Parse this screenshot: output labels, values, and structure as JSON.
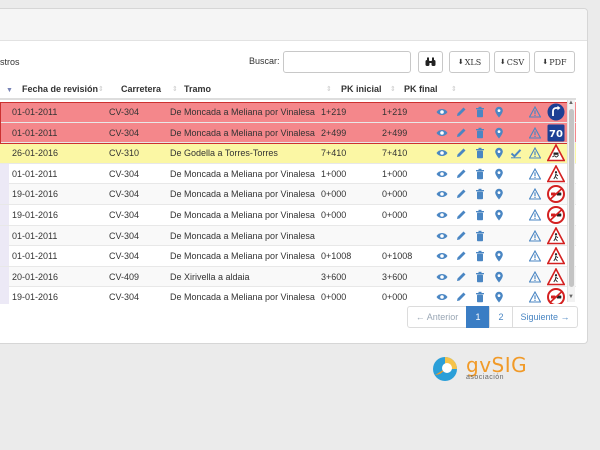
{
  "table_controls": {
    "length_label": "stros",
    "search_label": "Buscar:",
    "search_value": "",
    "export_xls": "XLS",
    "export_csv": "CSV",
    "export_pdf": "PDF",
    "download_glyph": "⬇"
  },
  "columns": [
    "Fecha de revisión",
    "Carretera",
    "Tramo",
    "PK inicial",
    "PK final"
  ],
  "rows": [
    {
      "fecha": "01-01-2011",
      "carretera": "CV-304",
      "tramo": "De Moncada a Meliana por Vinalesa",
      "pk_inicial": "1+219",
      "pk_final": "1+219",
      "state": "red",
      "actions": [
        "eye-icon",
        "pencil-icon",
        "trash-icon",
        "map-marker-icon",
        "warning-icon"
      ],
      "sign": "sign-direction-icon"
    },
    {
      "fecha": "01-01-2011",
      "carretera": "CV-304",
      "tramo": "De Moncada a Meliana por Vinalesa",
      "pk_inicial": "2+499",
      "pk_final": "2+499",
      "state": "red",
      "actions": [
        "eye-icon",
        "pencil-icon",
        "trash-icon",
        "map-marker-icon",
        "warning-icon"
      ],
      "sign": "sign-speed-70-icon",
      "sign_text": "70"
    },
    {
      "fecha": "26-01-2016",
      "carretera": "CV-310",
      "tramo": "De Godella a Torres-Torres",
      "pk_inicial": "7+410",
      "pk_final": "7+410",
      "state": "yellow",
      "actions": [
        "eye-icon",
        "pencil-icon",
        "trash-icon",
        "map-marker-icon",
        "check-icon",
        "warning-icon"
      ],
      "sign": "sign-slippery-road-icon"
    },
    {
      "fecha": "01-01-2011",
      "carretera": "CV-304",
      "tramo": "De Moncada a Meliana por Vinalesa",
      "pk_inicial": "1+000",
      "pk_final": "1+000",
      "state": "plain",
      "actions": [
        "eye-icon",
        "pencil-icon",
        "trash-icon",
        "map-marker-icon",
        "warning-icon"
      ],
      "sign": "sign-pedestrian-warning-icon"
    },
    {
      "fecha": "19-01-2016",
      "carretera": "CV-304",
      "tramo": "De Moncada a Meliana por Vinalesa",
      "pk_inicial": "0+000",
      "pk_final": "0+000",
      "state": "gray",
      "actions": [
        "eye-icon",
        "pencil-icon",
        "trash-icon",
        "map-marker-icon",
        "warning-icon"
      ],
      "sign": "sign-no-overtaking-icon"
    },
    {
      "fecha": "19-01-2016",
      "carretera": "CV-304",
      "tramo": "De Moncada a Meliana por Vinalesa",
      "pk_inicial": "0+000",
      "pk_final": "0+000",
      "state": "plain",
      "actions": [
        "eye-icon",
        "pencil-icon",
        "trash-icon",
        "map-marker-icon",
        "warning-icon"
      ],
      "sign": "sign-no-overtaking-icon"
    },
    {
      "fecha": "01-01-2011",
      "carretera": "CV-304",
      "tramo": "De Moncada a Meliana por Vinalesa",
      "pk_inicial": "",
      "pk_final": "",
      "state": "gray",
      "actions": [
        "eye-icon",
        "pencil-icon",
        "trash-icon",
        "warning-icon"
      ],
      "sign": "sign-pedestrian-warning-icon"
    },
    {
      "fecha": "01-01-2011",
      "carretera": "CV-304",
      "tramo": "De Moncada a Meliana por Vinalesa",
      "pk_inicial": "0+1008",
      "pk_final": "0+1008",
      "state": "plain",
      "actions": [
        "eye-icon",
        "pencil-icon",
        "trash-icon",
        "map-marker-icon",
        "warning-icon"
      ],
      "sign": "sign-pedestrian-warning-icon"
    },
    {
      "fecha": "20-01-2016",
      "carretera": "CV-409",
      "tramo": "De Xirivella a aldaia",
      "pk_inicial": "3+600",
      "pk_final": "3+600",
      "state": "gray",
      "actions": [
        "eye-icon",
        "pencil-icon",
        "trash-icon",
        "map-marker-icon",
        "warning-icon"
      ],
      "sign": "sign-pedestrian-warning-icon"
    },
    {
      "fecha": "19-01-2016",
      "carretera": "CV-304",
      "tramo": "De Moncada a Meliana por Vinalesa",
      "pk_inicial": "0+000",
      "pk_final": "0+000",
      "state": "plain",
      "actions": [
        "eye-icon",
        "pencil-icon",
        "trash-icon",
        "map-marker-icon",
        "warning-icon"
      ],
      "sign": "sign-no-overtaking-icon"
    }
  ],
  "pagination": {
    "prev": "← Anterior",
    "pages": [
      "1",
      "2"
    ],
    "current": "1",
    "next": "Siguiente →"
  },
  "branding": {
    "name": "gvSIG",
    "sub": "asociación"
  },
  "colors": {
    "row_red": "#f4878b",
    "row_yellow": "#fbf7a4",
    "accent_blue": "#3a7dc4",
    "action_blue": "#4a86c3",
    "logo_orange": "#f19a28"
  }
}
